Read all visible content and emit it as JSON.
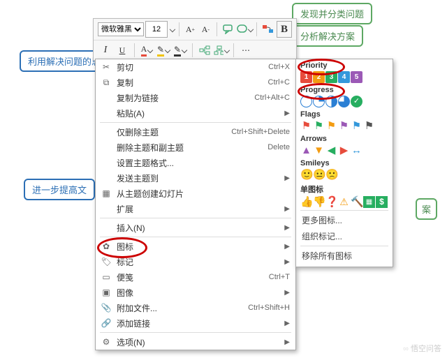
{
  "nodes": {
    "topRight1": "发现并分类问题",
    "topRight2": "分析解决方案",
    "selected": "利用解决问题的思路，组织文章的内容顺序",
    "left2": "进一步提高文",
    "farRight": "案"
  },
  "toolbar": {
    "font": "微软雅黑",
    "size": "12"
  },
  "menu": [
    {
      "icon": "✂",
      "label": "剪切",
      "sc": "Ctrl+X"
    },
    {
      "icon": "⧉",
      "label": "复制",
      "sc": "Ctrl+C"
    },
    {
      "icon": "",
      "label": "复制为链接",
      "sc": "Ctrl+Alt+C"
    },
    {
      "icon": "",
      "label": "粘贴(A)",
      "sub": true
    },
    {
      "sep": true
    },
    {
      "icon": "",
      "label": "仅删除主题",
      "sc": "Ctrl+Shift+Delete"
    },
    {
      "icon": "",
      "label": "删除主题和副主题",
      "sc": "Delete"
    },
    {
      "icon": "",
      "label": "设置主题格式...",
      "sc": ""
    },
    {
      "icon": "",
      "label": "发送主题到",
      "sub": true
    },
    {
      "icon": "▦",
      "label": "从主题创建幻灯片",
      "sc": ""
    },
    {
      "icon": "",
      "label": "扩展",
      "sub": true
    },
    {
      "sep": true
    },
    {
      "icon": "",
      "label": "插入(N)",
      "sub": true
    },
    {
      "sep": true
    },
    {
      "icon": "✿",
      "label": "图标",
      "sub": true,
      "hl": true
    },
    {
      "icon": "🏷",
      "label": "标记",
      "sub": true
    },
    {
      "icon": "▭",
      "label": "便笺",
      "sc": "Ctrl+T"
    },
    {
      "icon": "▣",
      "label": "图像",
      "sub": true
    },
    {
      "icon": "📎",
      "label": "附加文件...",
      "sc": "Ctrl+Shift+H"
    },
    {
      "icon": "🔗",
      "label": "添加链接",
      "sub": true
    },
    {
      "sep": true
    },
    {
      "icon": "⚙",
      "label": "选项(N)",
      "sub": true
    }
  ],
  "submenu": {
    "priority": "Priority",
    "progress": "Progress",
    "flags": "Flags",
    "arrows": "Arrows",
    "smileys": "Smileys",
    "single": "单图标",
    "more": "更多图标...",
    "org": "组织标记...",
    "remove": "移除所有图标"
  },
  "priorityColors": [
    "#e74c3c",
    "#f39c12",
    "#27ae60",
    "#3498db",
    "#9b59b6"
  ],
  "flagColors": [
    "#e74c3c",
    "#27ae60",
    "#f39c12",
    "#9b59b6",
    "#3498db",
    "#555"
  ],
  "arrowColors": [
    "#9b59b6",
    "#f39c12",
    "#27ae60",
    "#e74c3c",
    "#3498db"
  ],
  "watermark": "悟空问答"
}
